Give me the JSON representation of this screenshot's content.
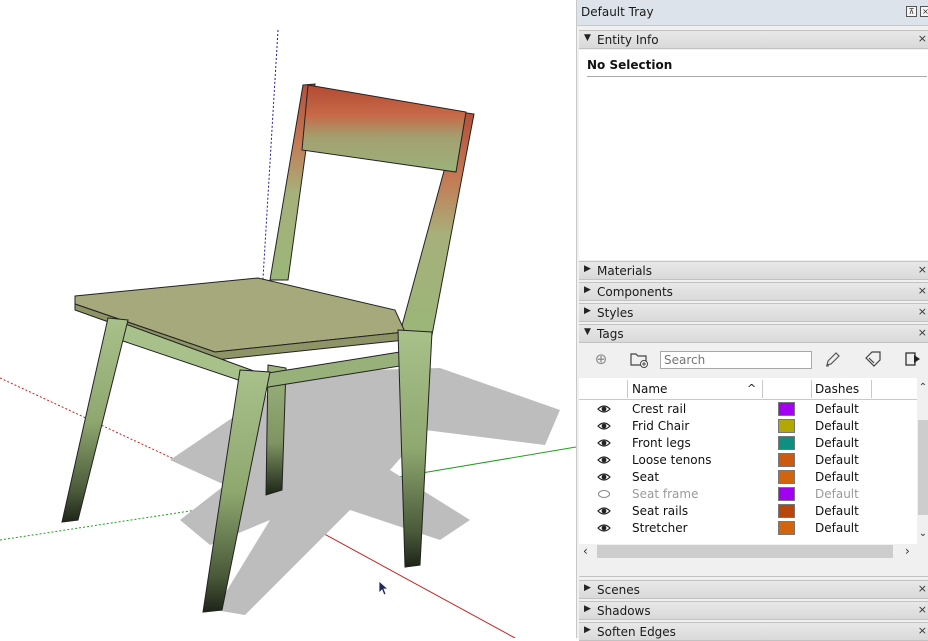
{
  "tray": {
    "title": "Default Tray",
    "pin_icon": "pin-icon",
    "close_icon": "close-icon"
  },
  "entity_info": {
    "title": "Entity Info",
    "expanded": true,
    "text": "No Selection"
  },
  "panels_collapsed_top": [
    {
      "title": "Materials"
    },
    {
      "title": "Components"
    },
    {
      "title": "Styles"
    }
  ],
  "tags": {
    "title": "Tags",
    "expanded": true,
    "toolbar": {
      "add_tag_icon": "add-tag-icon",
      "add_folder_icon": "add-folder-icon",
      "search_placeholder": "Search",
      "search_value": "",
      "color_by_tag_icon": "pencil-icon",
      "purge_icon": "tag-purge-icon",
      "details_icon": "details-arrow-icon"
    },
    "columns": {
      "name": "Name",
      "dashes": "Dashes",
      "sort_icon": "chevron-up-icon"
    },
    "rows": [
      {
        "name": "Crest rail",
        "visible": true,
        "color": "#a100f2",
        "dashes": "Default"
      },
      {
        "name": "Frid Chair",
        "visible": true,
        "color": "#b3a800",
        "dashes": "Default"
      },
      {
        "name": "Front legs",
        "visible": true,
        "color": "#0e9080",
        "dashes": "Default"
      },
      {
        "name": "Loose tenons",
        "visible": true,
        "color": "#cc5a10",
        "dashes": "Default"
      },
      {
        "name": "Seat",
        "visible": true,
        "color": "#d2640e",
        "dashes": "Default"
      },
      {
        "name": "Seat frame",
        "visible": false,
        "color": "#a100f2",
        "dashes": "Default"
      },
      {
        "name": "Seat rails",
        "visible": true,
        "color": "#b8460c",
        "dashes": "Default"
      },
      {
        "name": "Stretcher",
        "visible": true,
        "color": "#d2640e",
        "dashes": "Default"
      }
    ]
  },
  "panels_collapsed_bottom": [
    {
      "title": "Scenes"
    },
    {
      "title": "Shadows"
    },
    {
      "title": "Soften Edges"
    }
  ],
  "colors": {
    "tray_title_bg": "#dde3ea",
    "panel_bg": "#f0f0f0",
    "axis_red": "#cc0000",
    "axis_green": "#00a000",
    "axis_blue": "#0000cc"
  }
}
